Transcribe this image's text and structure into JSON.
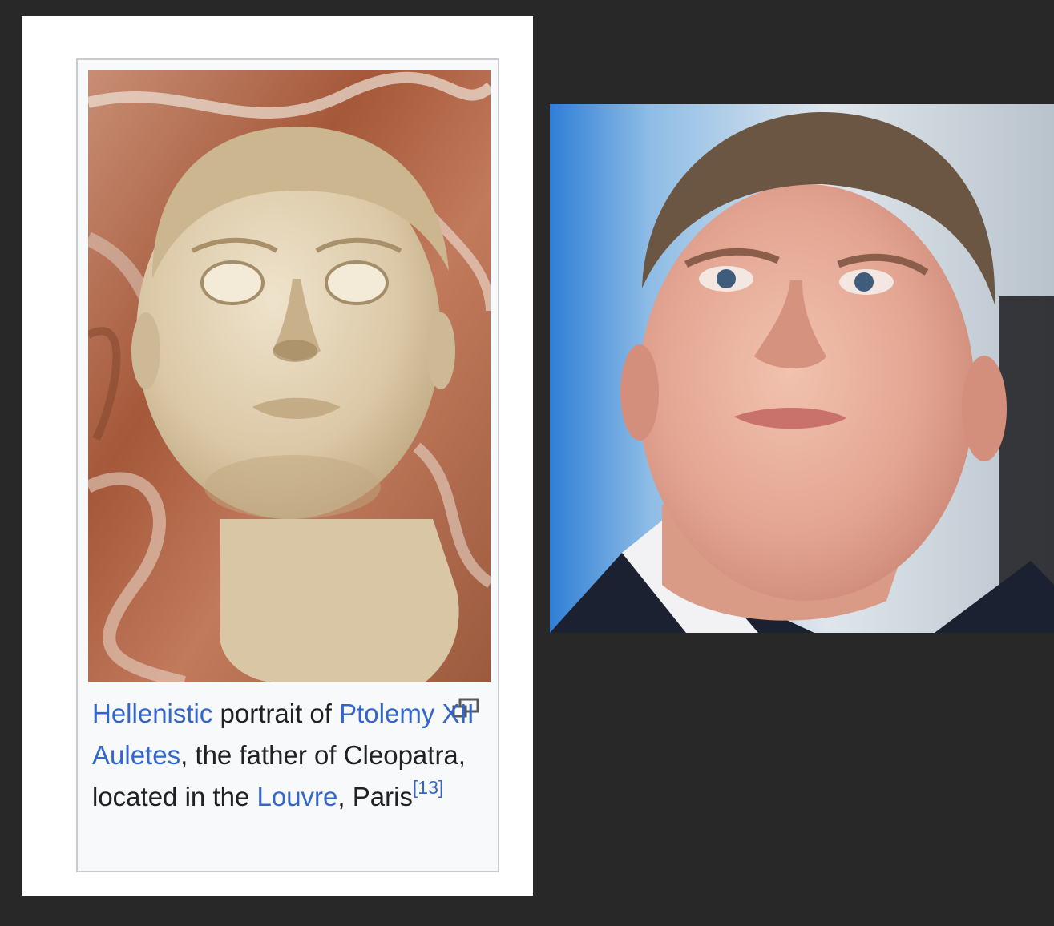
{
  "wiki_thumbnail": {
    "image": {
      "subject": "marble-bust-portrait",
      "alt": "Hellenistic portrait of Ptolemy XII Auletes"
    },
    "caption": {
      "link_hellenistic": "Hellenistic",
      "text_portrait_of": " portrait of ",
      "link_ptolemy": "Ptolemy XII Auletes",
      "text_the_father": ", the father of Cleopatra, located in the ",
      "link_louvre": "Louvre",
      "text_paris": ", Paris",
      "reference": "[13]"
    },
    "enlarge_icon": "magnify-clip-icon",
    "colors": {
      "link": "#3366cc",
      "text": "#202122",
      "border": "#c8ccd1",
      "background": "#f8f9fa"
    }
  },
  "photo": {
    "subject": "man-portrait-photo"
  },
  "colors": {
    "page_background": "#282828",
    "panel_background": "#ffffff"
  }
}
